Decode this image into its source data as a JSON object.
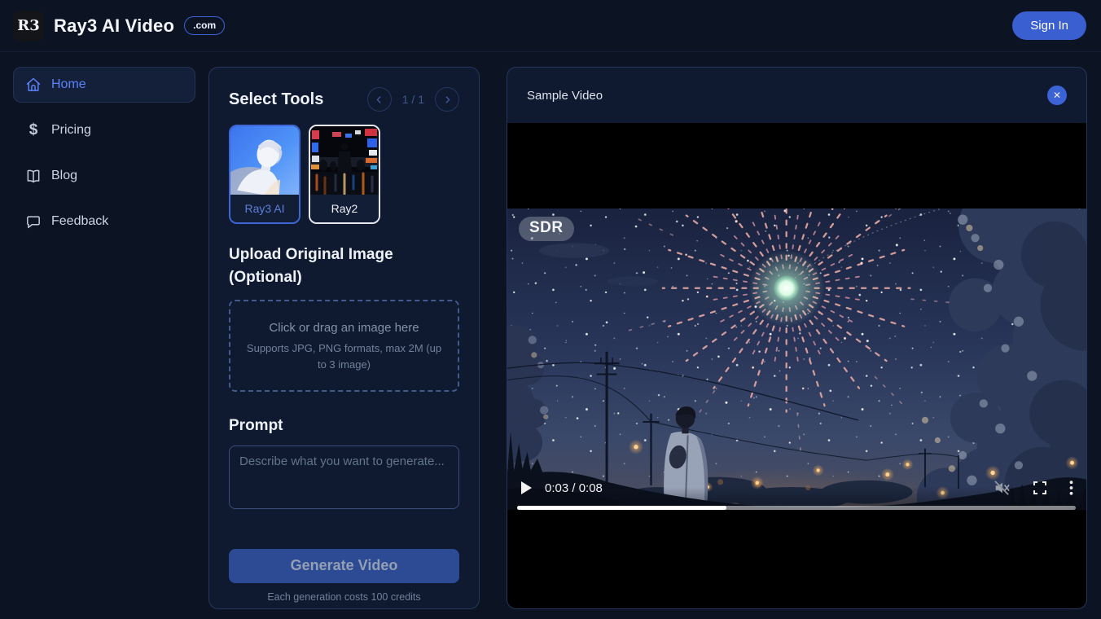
{
  "header": {
    "logo_text": "R3",
    "title": "Ray3 AI Video",
    "domain_badge": ".com",
    "sign_in_label": "Sign In"
  },
  "sidebar": {
    "items": [
      {
        "label": "Home",
        "icon": "home-icon",
        "active": true
      },
      {
        "label": "Pricing",
        "icon": "dollar-icon",
        "active": false
      },
      {
        "label": "Blog",
        "icon": "book-icon",
        "active": false
      },
      {
        "label": "Feedback",
        "icon": "chat-icon",
        "active": false
      }
    ]
  },
  "tools_panel": {
    "title": "Select Tools",
    "pagination": {
      "display": "1 / 1",
      "current": 1,
      "total": 1
    },
    "tools": [
      {
        "name": "Ray3 AI",
        "selected": true
      },
      {
        "name": "Ray2",
        "selected": false
      }
    ],
    "upload": {
      "heading": "Upload Original Image (Optional)",
      "dropzone_line1": "Click or drag an image here",
      "dropzone_line2": "Supports JPG, PNG formats, max 2M (up to 3 image)"
    },
    "prompt": {
      "label": "Prompt",
      "placeholder": "Describe what you want to generate..."
    },
    "generate_label": "Generate Video",
    "credits_note": "Each generation costs 100 credits"
  },
  "video_panel": {
    "title": "Sample Video",
    "badge": "SDR",
    "player": {
      "current_time": "0:03",
      "duration": "0:08",
      "time_display": "0:03 / 0:08",
      "progress_percent": 37.5,
      "progress_style": "width:37.5%",
      "muted": true
    }
  },
  "icons": {
    "close": "✕",
    "dollar": "$"
  },
  "colors": {
    "accent_blue": "#3b63d6",
    "selected_card_border": "#3f66d4",
    "page_background": "#0c1322",
    "panel_background": "#0f1a30",
    "panel_border": "#26365c",
    "active_nav_text": "#5b82f7"
  }
}
